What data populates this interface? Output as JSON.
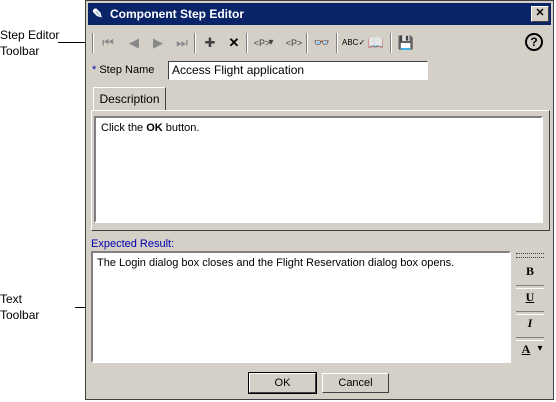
{
  "callouts": {
    "step_editor": [
      "Step Editor",
      "Toolbar"
    ],
    "text": [
      "Text",
      "Toolbar"
    ]
  },
  "window": {
    "title": "Component Step Editor",
    "close_glyph": "✕"
  },
  "toolbar": {
    "buttons": [
      {
        "name": "first-step",
        "glyph": "⏮"
      },
      {
        "name": "previous-step",
        "glyph": "◀"
      },
      {
        "name": "next-step",
        "glyph": "▶"
      },
      {
        "name": "last-step",
        "glyph": "⏭"
      },
      {
        "name": "new-step",
        "glyph": "✚"
      },
      {
        "name": "delete-step",
        "glyph": "✕"
      },
      {
        "name": "insert-parameter",
        "glyph": "<P>"
      },
      {
        "name": "parameter-dropdown",
        "glyph": "▾"
      },
      {
        "name": "parameter-options",
        "glyph": "<P>"
      },
      {
        "name": "find",
        "glyph": "👓"
      },
      {
        "name": "spell-check",
        "glyph": "ABC✓"
      },
      {
        "name": "thesaurus",
        "glyph": "📖"
      },
      {
        "name": "save",
        "glyph": "💾"
      }
    ],
    "help_glyph": "?"
  },
  "step": {
    "label": "Step Name",
    "required_mark": "*",
    "value": "Access Flight application"
  },
  "tabs": {
    "description": "Description"
  },
  "description": {
    "before": "Click the ",
    "bold": "OK",
    "after": " button."
  },
  "expected": {
    "label": "Expected Result:",
    "text": "The Login dialog box closes and the Flight Reservation dialog box opens."
  },
  "text_toolbar": {
    "bold": "B",
    "underline": "U",
    "italic": "I",
    "font_color": "A",
    "dropdown": "▾"
  },
  "buttons": {
    "ok": "OK",
    "cancel": "Cancel"
  }
}
